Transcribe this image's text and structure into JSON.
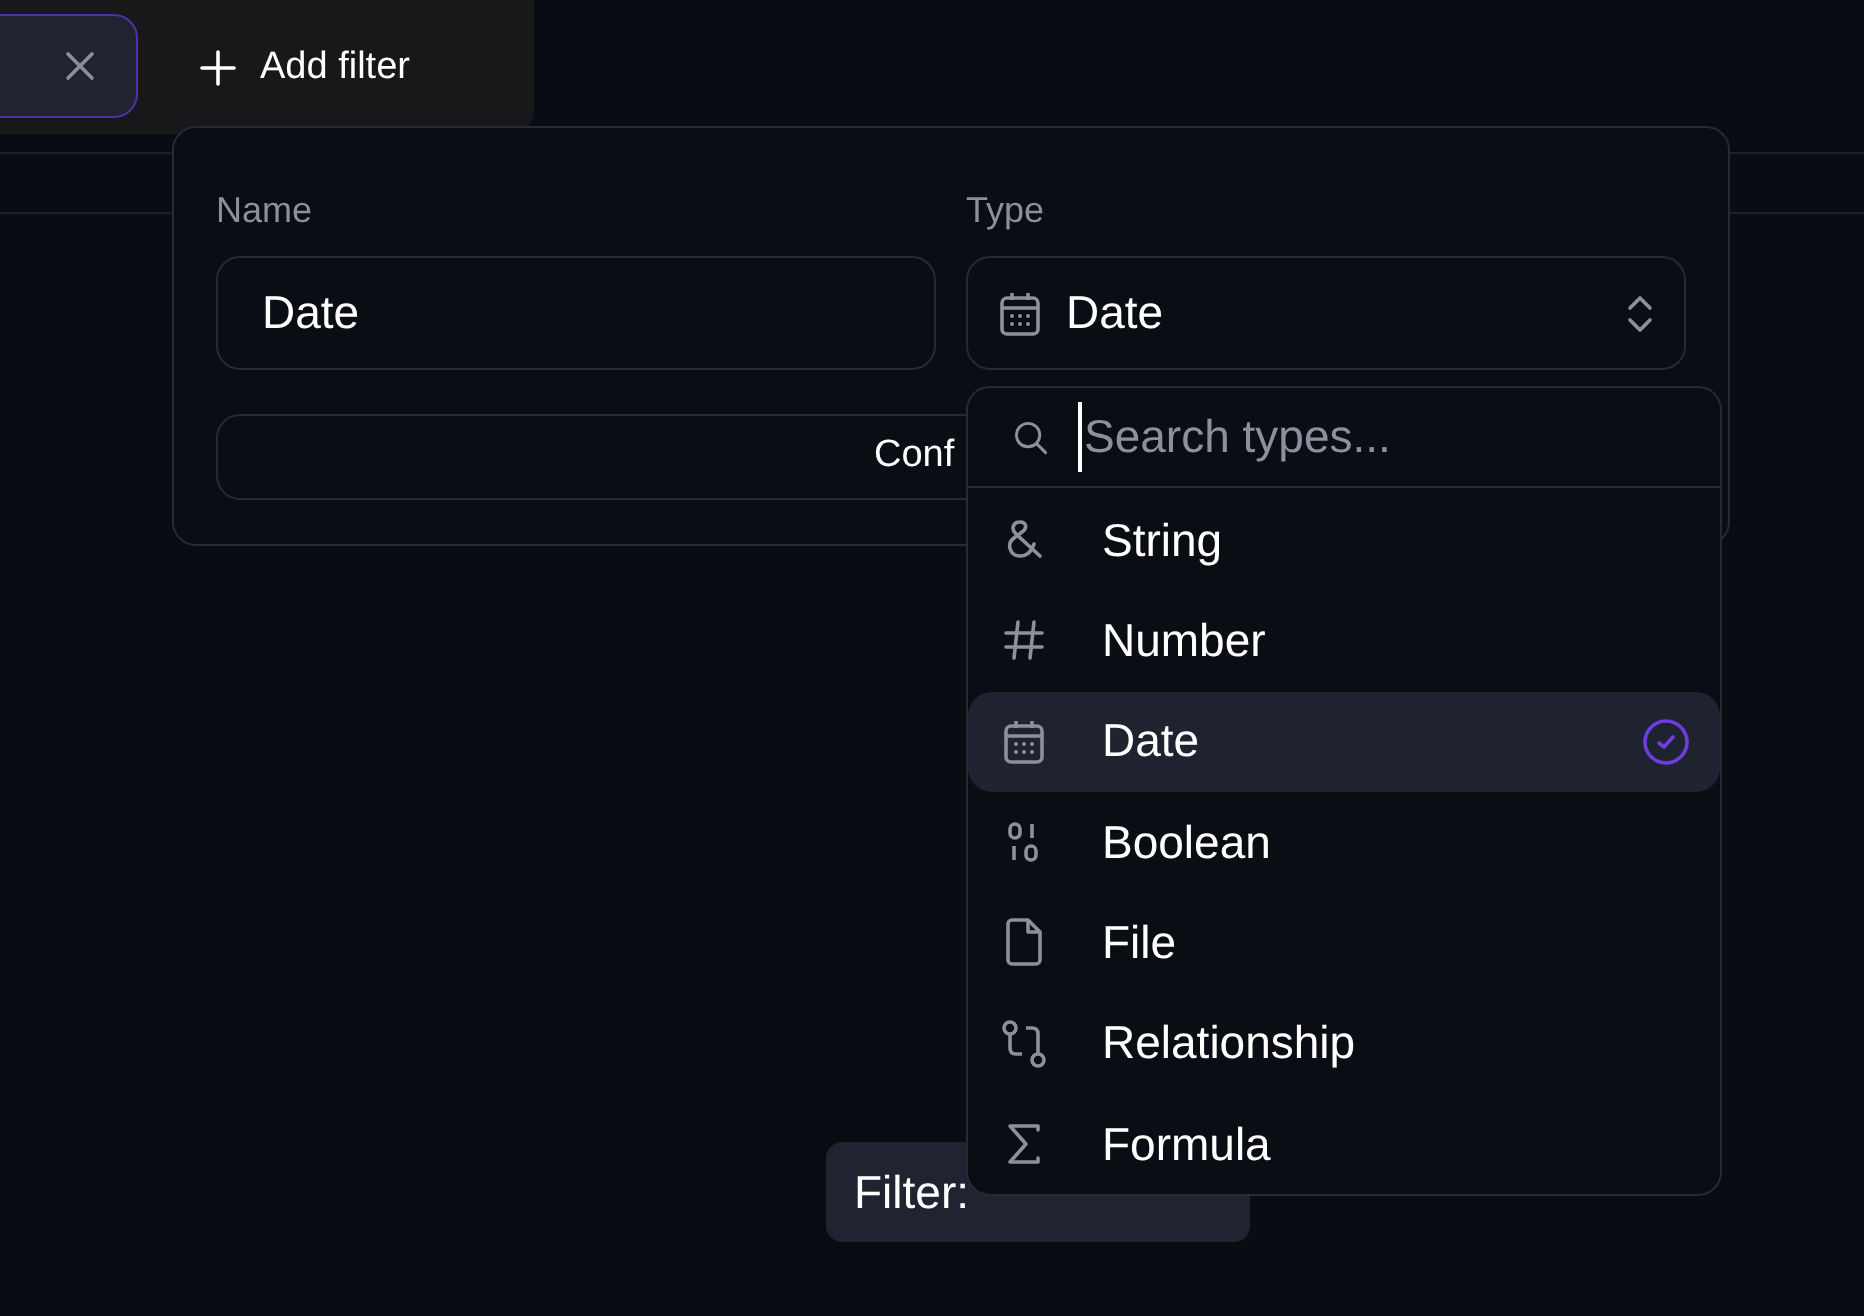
{
  "filter_chip": {
    "selected": true
  },
  "add_filter": {
    "label": "Add filter"
  },
  "filter_tag": {
    "label": "Filter:"
  },
  "popover": {
    "name_label": "Name",
    "name_value": "Date",
    "type_label": "Type",
    "type_value": "Date",
    "confirm": "Conf"
  },
  "dropdown": {
    "placeholder": "Search types...",
    "items": [
      {
        "kind": "string",
        "label": "String",
        "selected": false
      },
      {
        "kind": "number",
        "label": "Number",
        "selected": false
      },
      {
        "kind": "date",
        "label": "Date",
        "selected": true
      },
      {
        "kind": "boolean",
        "label": "Boolean",
        "selected": false
      },
      {
        "kind": "file",
        "label": "File",
        "selected": false
      },
      {
        "kind": "relationship",
        "label": "Relationship",
        "selected": false
      },
      {
        "kind": "formula",
        "label": "Formula",
        "selected": false
      }
    ]
  }
}
